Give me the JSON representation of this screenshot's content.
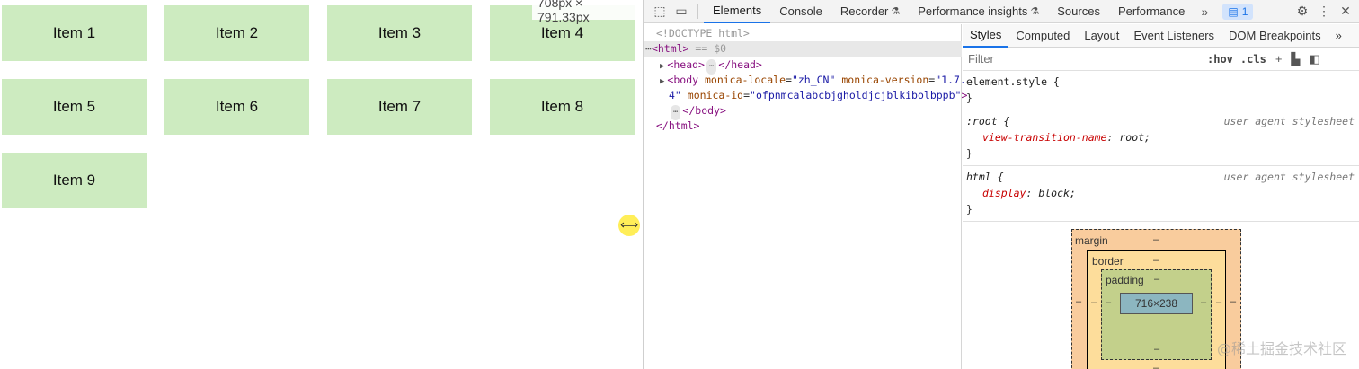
{
  "page": {
    "items": [
      "Item 1",
      "Item 2",
      "Item 3",
      "Item 4",
      "Item 5",
      "Item 6",
      "Item 7",
      "Item 8",
      "Item 9"
    ],
    "size_tooltip": "708px × 791.33px",
    "item_color": "#cdebc0"
  },
  "devtools": {
    "toolbar": {
      "tabs": [
        "Elements",
        "Console",
        "Recorder",
        "Performance insights",
        "Sources",
        "Performance"
      ],
      "more": "»",
      "issues_count": "1"
    },
    "elements": {
      "doctype": "<!DOCTYPE html>",
      "html_marker": "== $0",
      "head_open": "<head>",
      "head_close": "</head>",
      "body_tag": "<body",
      "attr_locale_name": "monica-locale",
      "attr_locale_value": "\"zh_CN\"",
      "attr_version_name": "monica-version",
      "attr_version_value": "\"1.7.",
      "attr_version_value_cont": "4\"",
      "attr_id_name": "monica-id",
      "attr_id_value": "\"ofpnmcalabcbjgholdjcjblkibolbppb\"",
      "body_close": "</body>",
      "html_open": "<html>",
      "html_close": "</html>"
    },
    "styles": {
      "tabs": [
        "Styles",
        "Computed",
        "Layout",
        "Event Listeners",
        "DOM Breakpoints"
      ],
      "more": "»",
      "filter_placeholder": "Filter",
      "hov": ":hov",
      "cls": ".cls",
      "rules": [
        {
          "selector": "element.style {",
          "origin": "",
          "prop": "",
          "value": "",
          "close": "}"
        },
        {
          "selector": ":root {",
          "origin": "user agent stylesheet",
          "prop": "view-transition-name",
          "value": "root;",
          "close": "}"
        },
        {
          "selector": "html {",
          "origin": "user agent stylesheet",
          "prop": "display",
          "value": "block;",
          "close": "}"
        }
      ],
      "box_model": {
        "margin_label": "margin",
        "border_label": "border",
        "padding_label": "padding",
        "content_size": "716×238",
        "dash": "–"
      }
    }
  },
  "watermark": "@稀土掘金技术社区"
}
